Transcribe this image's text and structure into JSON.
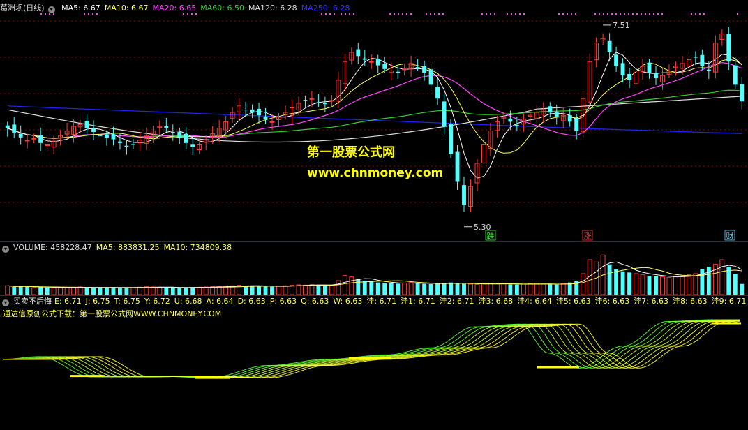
{
  "colors": {
    "bg": "#000000",
    "up": "#ff3b3b",
    "down": "#54ffff",
    "ma5": "#ffffff",
    "ma10": "#ffff55",
    "ma20": "#ff44ff",
    "ma60": "#33cc33",
    "ma120": "#dddddd",
    "ma250": "#2222ff",
    "grid": "#8a0000"
  },
  "main": {
    "title": "葛洲坝(日线)",
    "ma": [
      {
        "label": "MA5: 6.67",
        "color": "#ffffff"
      },
      {
        "label": "MA10: 6.67",
        "color": "#ffff55"
      },
      {
        "label": "MA20: 6.65",
        "color": "#ff44ff"
      },
      {
        "label": "MA60: 6.50",
        "color": "#33cc33"
      },
      {
        "label": "MA120: 6.28",
        "color": "#dddddd"
      },
      {
        "label": "MA250: 6.28",
        "color": "#3333ff"
      }
    ],
    "high_label": "7.51",
    "low_label": "5.30",
    "marks": [
      {
        "text": "跌",
        "color": "#33ff33"
      },
      {
        "text": "涨",
        "color": "#ff3333"
      },
      {
        "text": "财",
        "color": "#66ccff"
      }
    ]
  },
  "watermark": {
    "line1": "第一股票公式网",
    "line2": "www.chnmoney.com"
  },
  "volume": {
    "header": [
      {
        "label": "VOLUME: 458228.47",
        "color": "#dddddd"
      },
      {
        "label": "MA5: 883831.25",
        "color": "#ffff55"
      },
      {
        "label": "MA10: 734809.38",
        "color": "#ffff55"
      }
    ]
  },
  "indicator": {
    "name": "买卖不后悔",
    "values": [
      {
        "label": "E: 6.71"
      },
      {
        "label": "J: 6.75"
      },
      {
        "label": "T: 6.75"
      },
      {
        "label": "Y: 6.72"
      },
      {
        "label": "U: 6.68"
      },
      {
        "label": "A: 6.64"
      },
      {
        "label": "D: 6.63"
      },
      {
        "label": "P: 6.63"
      },
      {
        "label": "Q: 6.63"
      },
      {
        "label": "W: 6.63"
      },
      {
        "label": "洼: 6.71"
      },
      {
        "label": "洼1: 6.71"
      },
      {
        "label": "洼2: 6.71"
      },
      {
        "label": "洼3: 6.68"
      },
      {
        "label": "洼4: 6.64"
      },
      {
        "label": "洼5: 6.63"
      },
      {
        "label": "洼6: 6.63"
      },
      {
        "label": "洼7: 6.63"
      },
      {
        "label": "洼8: 6.63"
      },
      {
        "label": "洼9: 6.71"
      }
    ],
    "note": "通达信原创公式下载：第一股票公式网WWW.CHNMONEY.COM"
  },
  "chart_data": {
    "type": "candlestick",
    "y_range": [
      5.2,
      7.6
    ],
    "high": 7.51,
    "low": 5.3,
    "close": [
      6.38,
      6.33,
      6.28,
      6.25,
      6.27,
      6.22,
      6.2,
      6.24,
      6.3,
      6.35,
      6.4,
      6.42,
      6.38,
      6.34,
      6.3,
      6.28,
      6.26,
      6.22,
      6.18,
      6.2,
      6.25,
      6.3,
      6.35,
      6.4,
      6.38,
      6.33,
      6.28,
      6.22,
      6.18,
      6.2,
      6.26,
      6.32,
      6.38,
      6.45,
      6.55,
      6.62,
      6.58,
      6.55,
      6.52,
      6.48,
      6.45,
      6.5,
      6.55,
      6.6,
      6.65,
      6.68,
      6.7,
      6.66,
      6.64,
      6.68,
      6.9,
      7.1,
      7.2,
      7.16,
      7.12,
      7.1,
      7.06,
      7.02,
      7.0,
      6.98,
      7.02,
      7.08,
      7.04,
      6.98,
      6.85,
      6.7,
      6.4,
      6.1,
      5.8,
      5.55,
      5.75,
      6.0,
      6.2,
      6.35,
      6.45,
      6.5,
      6.45,
      6.4,
      6.48,
      6.52,
      6.55,
      6.58,
      6.55,
      6.5,
      6.52,
      6.45,
      6.35,
      6.7,
      7.1,
      7.3,
      7.35,
      7.2,
      7.05,
      6.95,
      6.9,
      7.0,
      7.05,
      6.98,
      6.92,
      6.95,
      7.0,
      7.05,
      7.08,
      7.12,
      7.15,
      7.05,
      7.0,
      7.3,
      7.4,
      7.1,
      6.85,
      6.67
    ],
    "volume": [
      380000,
      330000,
      360000,
      340000,
      300000,
      320000,
      310000,
      300000,
      290000,
      300000,
      320000,
      330000,
      310000,
      290000,
      300000,
      310000,
      320000,
      300000,
      290000,
      300000,
      320000,
      340000,
      330000,
      320000,
      310000,
      300000,
      290000,
      300000,
      310000,
      320000,
      330000,
      340000,
      350000,
      360000,
      380000,
      400000,
      390000,
      380000,
      360000,
      350000,
      340000,
      360000,
      380000,
      400000,
      420000,
      410000,
      430000,
      420000,
      400000,
      410000,
      600000,
      820000,
      760000,
      650000,
      600000,
      560000,
      520000,
      500000,
      480000,
      470000,
      500000,
      520000,
      480000,
      460000,
      450000,
      470000,
      500000,
      520000,
      480000,
      460000,
      450000,
      440000,
      460000,
      480000,
      470000,
      460000,
      440000,
      430000,
      450000,
      470000,
      460000,
      450000,
      440000,
      430000,
      470000,
      520000,
      580000,
      900000,
      1500000,
      1400000,
      1700000,
      1300000,
      1100000,
      1000000,
      950000,
      900000,
      850000,
      800000,
      780000,
      760000,
      740000,
      760000,
      800000,
      850000,
      900000,
      1100000,
      1200000,
      1300000,
      1500000,
      1200000,
      900000,
      458228
    ],
    "ma5_last": 6.67,
    "ma10_last": 6.67,
    "ma20_last": 6.65,
    "ma60_last": 6.5,
    "ma120_last": 6.28,
    "ma250_last": 6.28
  }
}
